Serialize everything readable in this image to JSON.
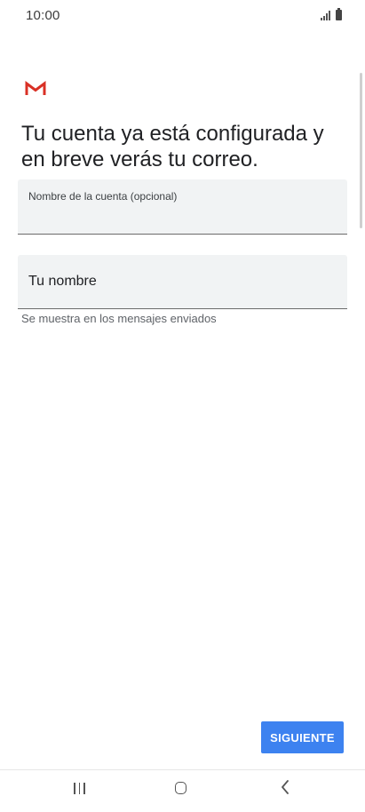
{
  "status_bar": {
    "time": "10:00",
    "signal_icon": "signal-icon",
    "battery_icon": "battery-icon"
  },
  "app": {
    "logo_icon": "gmail-logo-icon",
    "headline": "Tu cuenta ya está configurada y en breve verás tu correo."
  },
  "form": {
    "account_name_label": "Nombre de la cuenta (opcional)",
    "account_name_value": "",
    "your_name_placeholder": "Tu nombre",
    "your_name_value": "",
    "your_name_helper": "Se muestra en los mensajes enviados"
  },
  "actions": {
    "next_label": "SIGUIENTE"
  },
  "nav_bar": {
    "recent_icon": "recent-apps-icon",
    "home_icon": "home-icon",
    "back_icon": "back-icon"
  },
  "colors": {
    "accent": "#3d82f0",
    "gmail_red": "#d93025",
    "field_background": "#f1f3f4"
  }
}
